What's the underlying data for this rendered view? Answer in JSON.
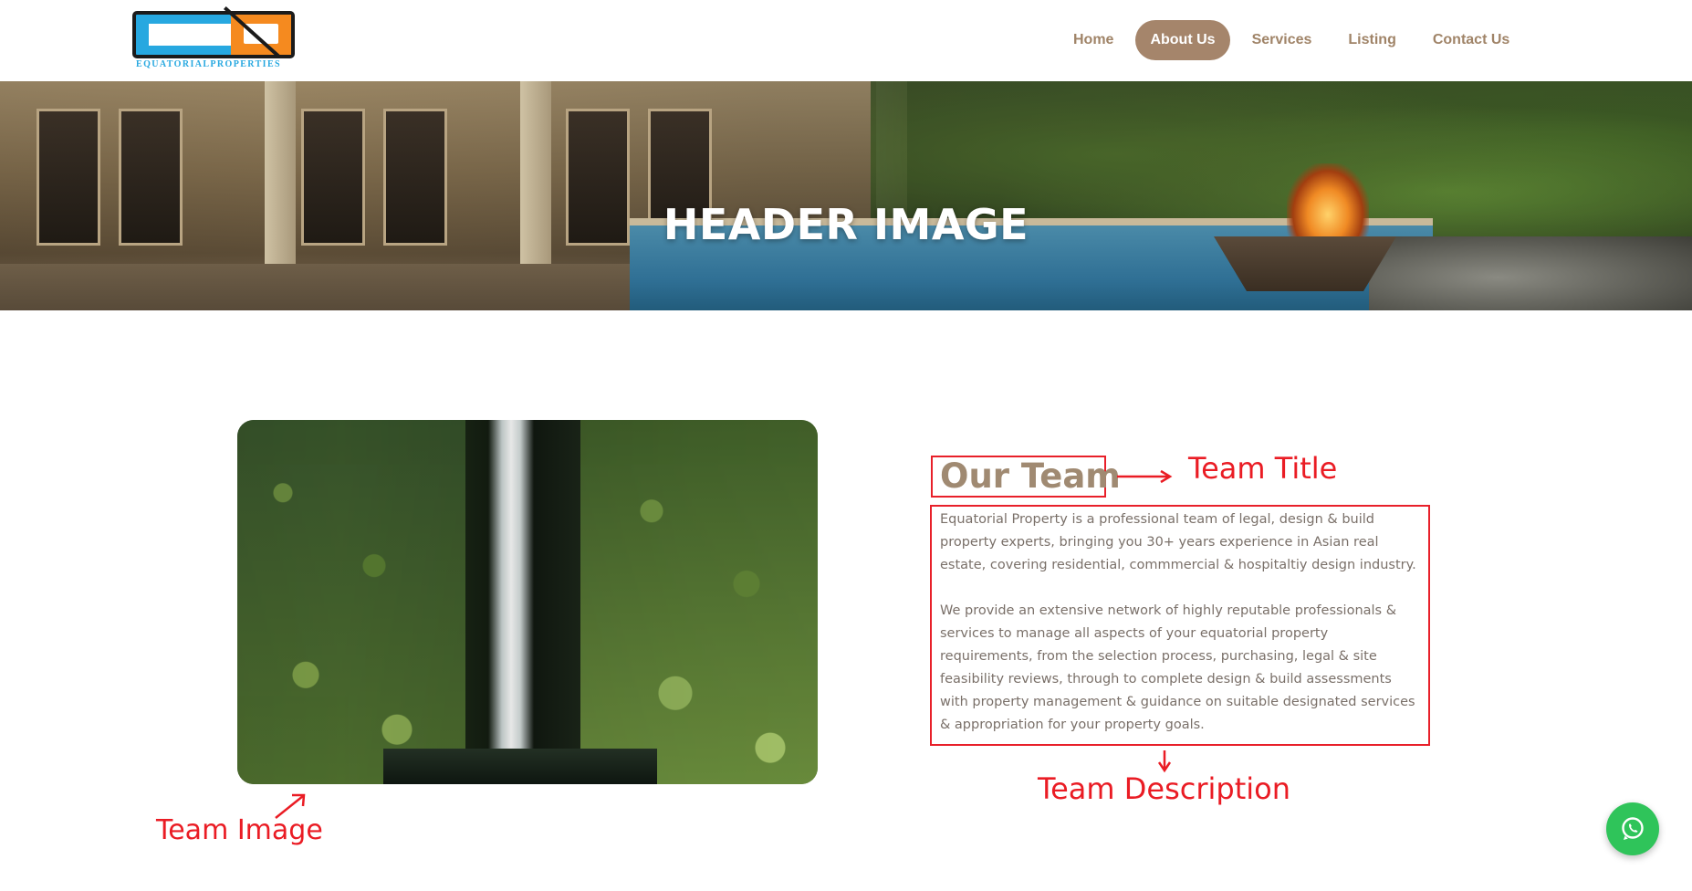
{
  "logo": {
    "text": "EQUATORIALPROPERTIES"
  },
  "nav": {
    "items": [
      {
        "label": "Home",
        "active": false
      },
      {
        "label": "About Us",
        "active": true
      },
      {
        "label": "Services",
        "active": false
      },
      {
        "label": "Listing",
        "active": false
      },
      {
        "label": "Contact Us",
        "active": false
      }
    ]
  },
  "hero": {
    "title": "HEADER IMAGE"
  },
  "team": {
    "title": "Our Team",
    "description": [
      "Equatorial Property is a professional team of legal, design & build property experts, bringing you 30+ years experience in Asian real estate, covering residential, commmercial & hospitaltiy design industry.",
      "We provide an extensive network of highly reputable professionals & services to manage all aspects of your equatorial property requirements, from the selection process, purchasing, legal & site feasibility reviews, through to complete design & build assessments with property management & guidance on suitable designated services & appropriation for your property goals."
    ]
  },
  "annotations": {
    "team_title": "Team Title",
    "team_description": "Team Description",
    "team_image": "Team Image"
  },
  "colors": {
    "accent": "#a5856b",
    "nav_text": "#a08468",
    "annotation": "#ea1c24",
    "whatsapp": "#2fc45a"
  },
  "icons": {
    "whatsapp": "whatsapp-icon"
  }
}
